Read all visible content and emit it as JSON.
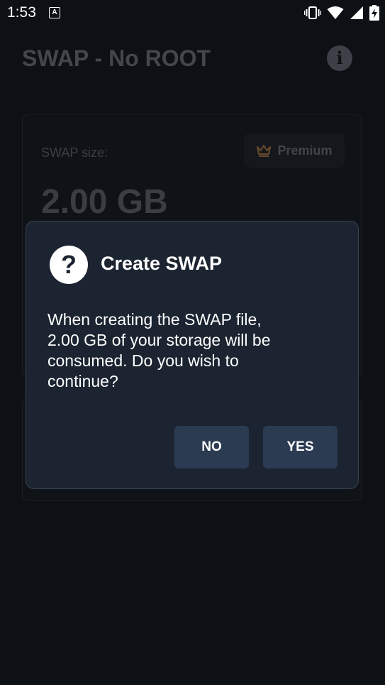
{
  "status_bar": {
    "time": "1:53",
    "notification_icon": "a-letter-icon",
    "icons": [
      "vibrate-icon",
      "wifi-icon",
      "signal-icon",
      "battery-charging-icon"
    ]
  },
  "app_bar": {
    "title": "SWAP - No ROOT",
    "info_icon": "info-icon"
  },
  "swap_card": {
    "size_label": "SWAP size:",
    "premium_label": "Premium",
    "size_value": "2.00 GB"
  },
  "dialog": {
    "icon": "question-icon",
    "title": "Create SWAP",
    "message": "When creating the SWAP file, 2.00 GB of your storage will be consumed. Do you wish to continue?",
    "no_label": "NO",
    "yes_label": "YES"
  },
  "colors": {
    "background": "#0d1014",
    "dialog_bg": "#1b2430",
    "button_bg": "#2b3b52",
    "crown": "#6a4a2c"
  }
}
